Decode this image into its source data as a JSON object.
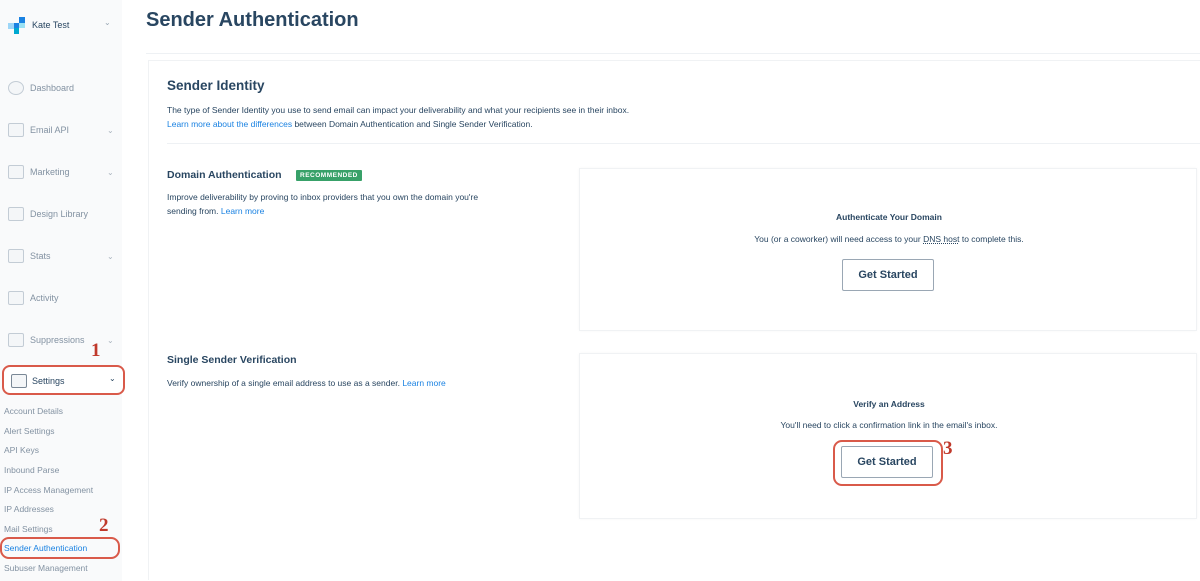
{
  "account": {
    "name": "Kate Test"
  },
  "nav": {
    "items": [
      {
        "label": "Dashboard",
        "chevron": false
      },
      {
        "label": "Email API",
        "chevron": true
      },
      {
        "label": "Marketing",
        "chevron": true
      },
      {
        "label": "Design Library",
        "chevron": false
      },
      {
        "label": "Stats",
        "chevron": true
      },
      {
        "label": "Activity",
        "chevron": false
      },
      {
        "label": "Suppressions",
        "chevron": true
      }
    ],
    "settings_label": "Settings",
    "sub_items": [
      "Account Details",
      "Alert Settings",
      "API Keys",
      "Inbound Parse",
      "IP Access Management",
      "IP Addresses",
      "Mail Settings",
      "Sender Authentication",
      "Subuser Management"
    ]
  },
  "markers": {
    "one": "1",
    "two": "2",
    "three": "3"
  },
  "page": {
    "title": "Sender Authentication",
    "identity": {
      "title": "Sender Identity",
      "desc_line1": "The type of Sender Identity you use to send email can impact your deliverability and what your recipients see in their inbox.",
      "desc_link": "Learn more about the differences",
      "desc_line2_rest": " between Domain Authentication and Single Sender Verification."
    },
    "domain": {
      "title": "Domain Authentication",
      "badge": "RECOMMENDED",
      "desc": "Improve deliverability by proving to inbox providers that you own the domain you're sending from. ",
      "link": "Learn more",
      "card_title": "Authenticate Your Domain",
      "card_desc_pre": "You (or a coworker) will need access to your ",
      "card_desc_dns": "DNS host",
      "card_desc_post": " to complete this.",
      "button": "Get Started"
    },
    "single": {
      "title": "Single Sender Verification",
      "desc": "Verify ownership of a single email address to use as a sender. ",
      "link": "Learn more",
      "card_title": "Verify an Address",
      "card_desc": "You'll need to click a confirmation link in the email's inbox.",
      "button": "Get Started"
    }
  },
  "colors": {
    "accent": "#1a82e2",
    "badge": "#38a169",
    "annotation": "#d95a4a",
    "text": "#294661"
  }
}
